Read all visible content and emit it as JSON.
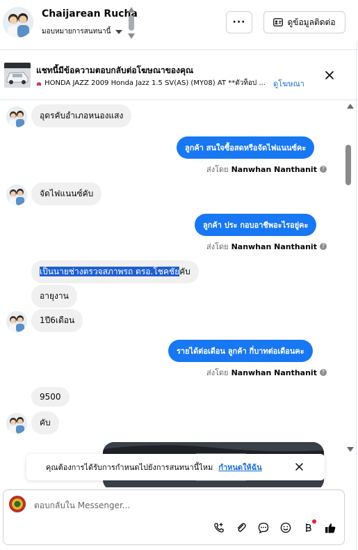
{
  "header": {
    "name": "Chaijarean Rucha",
    "assign_label": "มอบหมายการสนทนานี้",
    "more_label": "···",
    "contact_button": "ดูข้อมูลติดต่อ"
  },
  "ad": {
    "title": "แชทนี้มีข้อความตอบกลับต่อโฆษณาของคุณ",
    "detail": "HONDA JAZZ 2009 Honda Jazz 1.5 SV(AS) (MY08) AT **ตัวท็อป ...",
    "link": "ดูโฆษณา"
  },
  "messages": [
    {
      "text": "อุดรคับอำเภอหนองแสง"
    },
    {
      "text": "ลูกค้า สนใจซื้อสดหรือจัดไฟแนนซ์คะ",
      "sent_prefix": "ส่งโดย",
      "sender": "Nanwhan Nanthanit"
    },
    {
      "text": "จัดไฟแนนซ์คับ"
    },
    {
      "text": "ลูกค้า ประ กอบอาชีพอะไรอยู่คะ",
      "sent_prefix": "ส่งโดย",
      "sender": "Nanwhan Nanthanit"
    },
    {
      "text_selected": "เป็นนายช่างตรวจสภาพรถ ตรอ.โชคชัย",
      "text_rest": "คับ"
    },
    {
      "text": "อายุงาน"
    },
    {
      "text": "1ปี6เดือน"
    },
    {
      "text": "รายได้ต่อเดือน  ลูกค้า กี่บาทต่อเดือนคะ",
      "sent_prefix": "ส่งโดย",
      "sender": "Nanwhan Nanthanit"
    },
    {
      "text": "9500"
    },
    {
      "text": "คับ"
    }
  ],
  "notify": {
    "text": "คุณต้องการได้รับการกำหนดไปยังการสนทนานี้ไหม",
    "link": "กำหนดให้ฉัน"
  },
  "composer": {
    "placeholder": "ตอบกลับใน Messenger..."
  },
  "colors": {
    "accent": "#1877f2",
    "incoming_bubble": "#f0f0f0",
    "link": "#1a6ed8",
    "notify_dot": "#e41e3f"
  },
  "icons": [
    "more-icon",
    "contact-card-icon",
    "close-icon",
    "info-icon",
    "add-call-icon",
    "attach-icon",
    "saved-reply-icon",
    "emoji-icon",
    "baht-icon",
    "like-icon"
  ]
}
